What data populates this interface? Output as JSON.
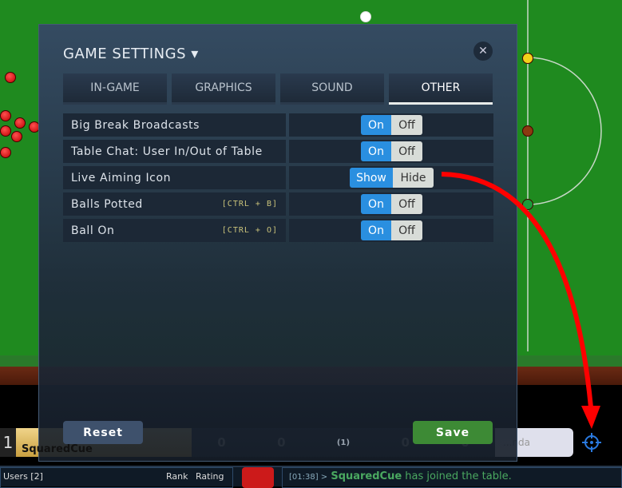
{
  "modal": {
    "title": "GAME SETTINGS ▾",
    "close_icon": "close-icon",
    "tabs": [
      {
        "label": "IN-GAME"
      },
      {
        "label": "GRAPHICS"
      },
      {
        "label": "SOUND"
      },
      {
        "label": "OTHER",
        "active": true
      }
    ],
    "rows": [
      {
        "label": "Big Break Broadcasts",
        "shortcut": "",
        "on": "On",
        "off": "Off",
        "value": "On"
      },
      {
        "label": "Table Chat: User In/Out of Table",
        "shortcut": "",
        "on": "On",
        "off": "Off",
        "value": "On"
      },
      {
        "label": "Live Aiming Icon",
        "shortcut": "",
        "on": "Show",
        "off": "Hide",
        "value": "Show"
      },
      {
        "label": "Balls Potted",
        "shortcut": "[CTRL + B]",
        "on": "On",
        "off": "Off",
        "value": "On"
      },
      {
        "label": "Ball On",
        "shortcut": "[CTRL + O]",
        "on": "On",
        "off": "Off",
        "value": "On"
      }
    ],
    "reset": "Reset",
    "save": "Save"
  },
  "scorebar": {
    "position": "1",
    "player1": "SquaredCue",
    "score1": "0",
    "frame_left": "0",
    "frames": "(1)",
    "frame_right": "0",
    "score2": "0",
    "player2": "...nda"
  },
  "bottom": {
    "users": "Users [2]",
    "rank": "Rank",
    "rating": "Rating",
    "chat_time": "[01:38] >",
    "chat_user": "SquaredCue",
    "chat_msg": " has joined the table."
  },
  "colors": {
    "accent": "#2a8fe0",
    "save": "#3d8a35",
    "felt": "#1f8a1f",
    "arrow": "#ff0000"
  }
}
